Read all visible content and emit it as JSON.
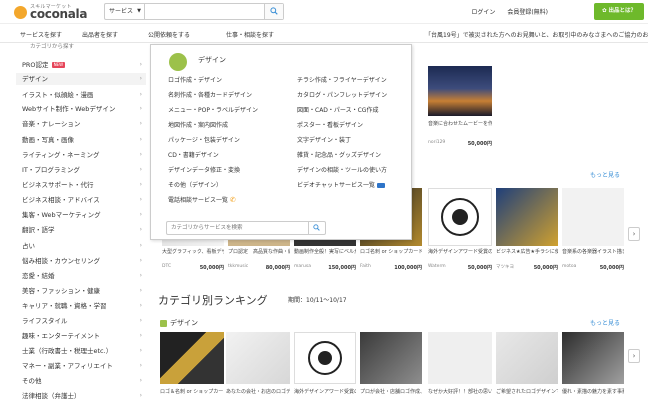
{
  "header": {
    "logo_tagline": "スキルマーケット",
    "logo_name": "coconala",
    "search_select": "サービス",
    "search_placeholder": "",
    "login": "ログイン",
    "signup": "会員登録(無料)",
    "kbtn": "✿ 出品とは？",
    "accent_green": "#6eb92b"
  },
  "nav": {
    "items": [
      "サービスを探す",
      "出品者を探す",
      "公開依頼をする",
      "仕事・相談を探す"
    ],
    "notice": "「台風19号」で被災された方へのお見舞いと、お取引中のみなさまへのご協力のお願い"
  },
  "sidebar": {
    "top": "カテゴリから探す",
    "items": [
      {
        "label": "PRO認定",
        "badge": "NEW"
      },
      {
        "label": "デザイン"
      },
      {
        "label": "イラスト・似顔絵・漫画"
      },
      {
        "label": "Webサイト制作・Webデザイン"
      },
      {
        "label": "音楽・ナレーション"
      },
      {
        "label": "動画・写真・画像"
      },
      {
        "label": "ライティング・ネーミング"
      },
      {
        "label": "IT・プログラミング"
      },
      {
        "label": "ビジネスサポート・代行"
      },
      {
        "label": "ビジネス相談・アドバイス"
      },
      {
        "label": "集客・Webマーケティング"
      },
      {
        "label": "翻訳・語学"
      },
      {
        "label": "占い"
      },
      {
        "label": "悩み相談・カウンセリング"
      },
      {
        "label": "恋愛・結婚"
      },
      {
        "label": "美容・ファッション・健康"
      },
      {
        "label": "キャリア・就職・資格・学習"
      },
      {
        "label": "ライフスタイル"
      },
      {
        "label": "趣味・エンターテイメント"
      },
      {
        "label": "士業（行政書士・税理士etc.）"
      },
      {
        "label": "マネー・副業・アフィリエイト"
      },
      {
        "label": "その他"
      },
      {
        "label": "法律相談（弁護士）"
      }
    ]
  },
  "flyout": {
    "title": "デザイン",
    "left": [
      "ロゴ作成・デザイン",
      "名刺作成・各種カードデザイン",
      "メニュー・POP・ラベルデザイン",
      "地図作成・案内図作成",
      "パッケージ・包装デザイン",
      "CD・書籍デザイン",
      "デザインデータ修正・変換",
      "その他（デザイン）",
      "電話相談サービス一覧"
    ],
    "right": [
      "チラシ作成・フライヤーデザイン",
      "カタログ・パンフレットデザイン",
      "図面・CAD・パース・CG作成",
      "ポスター・看板デザイン",
      "文字デザイン・装丁",
      "雑貨・記念品・グッズデザイン",
      "デザインの相談・ツールの使い方",
      "ビデオチャットサービス一覧"
    ],
    "search_placeholder": "カテゴリからサービスを検索"
  },
  "cards_top": [
    {
      "title": "音楽に合わせたムービーを作成します",
      "user": "nori129",
      "price": "50,000円"
    }
  ],
  "motto": "もっと見る",
  "cards_mid": [
    {
      "title": "大型グラフィック、看板デザイン、制作します",
      "user": "DTC",
      "price": "50,000円"
    },
    {
      "title": "プロ認定　高品質な作曲・編曲・プロデュース",
      "user": "tkkmusic",
      "price": "80,000円"
    },
    {
      "title": "動画制作全般！実写にベルから5NS用まで",
      "user": "marusa",
      "price": "150,000円"
    },
    {
      "title": "ロゴ名刺 or ショップカード等を…",
      "user": "Faith",
      "price": "100,000円"
    },
    {
      "title": "海外デザインアワード受賞のプロがロゴを",
      "user": "Waterm",
      "price": "50,000円"
    },
    {
      "title": "ビジネス★広告★手ラシに使える",
      "user": "マツキヨ",
      "price": "50,000円"
    },
    {
      "title": "音楽系の各楽器イラスト描きます書籍・",
      "user": "motoa",
      "price": "50,000円"
    }
  ],
  "ranking": {
    "title": "カテゴリ別ランキング",
    "period": "期間：10/11〜10/17",
    "category": "デザイン"
  },
  "cards_bottom": [
    {
      "rank": "1",
      "title": "ロゴ＆名刺 or ショップカード等を…"
    },
    {
      "rank": "2",
      "title": "あなたの会社・お店のロゴデザイン作ります"
    },
    {
      "rank": "3",
      "title": "海外デザインアワード受賞のプロがロゴデ"
    },
    {
      "rank": "4",
      "title": "プロが会社・店舗ロゴ作成、チームエンブレ"
    },
    {
      "rank": "5",
      "title": "なぜか大好評！！部社の思い出ロゴに"
    },
    {
      "rank": "6",
      "title": "ご希望されたロゴデザインでイメージ強化を"
    },
    {
      "rank": "7",
      "title": "優れ・素描の魅力を素す事務くデザイン致し"
    }
  ]
}
